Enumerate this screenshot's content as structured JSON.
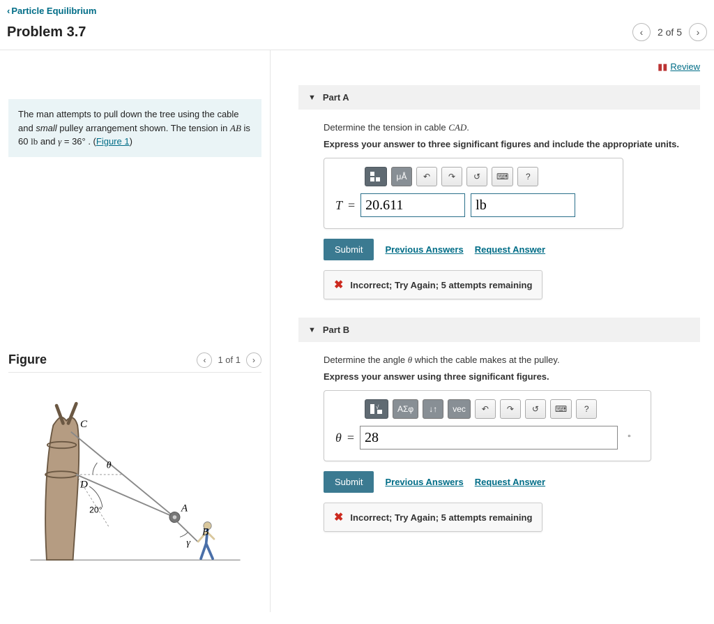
{
  "nav": {
    "back_label": "Particle Equilibrium",
    "problem_title": "Problem 3.7",
    "pager_text": "2 of 5"
  },
  "review_label": "Review",
  "prompt": {
    "line1a": "The man attempts to pull down the tree using the cable and ",
    "line1b": "small",
    "line1c": " pulley arrangement shown. The tension in ",
    "ab": "AB",
    "line2a": " is 60 ",
    "lb": "lb",
    "line2b": " and ",
    "gamma": "γ",
    "line2c": " = 36° . (",
    "fig_link": "Figure 1",
    "line2d": ")"
  },
  "figure": {
    "heading": "Figure",
    "pager": "1 of 1",
    "labels": {
      "C": "C",
      "D": "D",
      "A": "A",
      "B": "B",
      "theta": "θ",
      "gamma": "γ",
      "twenty": "20°"
    }
  },
  "partA": {
    "title": "Part A",
    "q1a": "Determine the tension in cable ",
    "q1b": "CAD",
    "q1c": ".",
    "q2": "Express your answer to three significant figures and include the appropriate units.",
    "ua": "μÅ",
    "var": "T",
    "eq": "=",
    "value": "20.611",
    "unit": "lb",
    "submit": "Submit",
    "prev": "Previous Answers",
    "req": "Request Answer",
    "feedback": "Incorrect; Try Again; 5 attempts remaining"
  },
  "partB": {
    "title": "Part B",
    "q1a": "Determine the angle ",
    "q1b": "θ",
    "q1c": " which the cable makes at the pulley.",
    "q2": "Express your answer using three significant figures.",
    "asf": "ΑΣφ",
    "vec": "vec",
    "var": "θ",
    "eq": "=",
    "value": "28",
    "deg": "°",
    "submit": "Submit",
    "prev": "Previous Answers",
    "req": "Request Answer",
    "feedback": "Incorrect; Try Again; 5 attempts remaining"
  }
}
